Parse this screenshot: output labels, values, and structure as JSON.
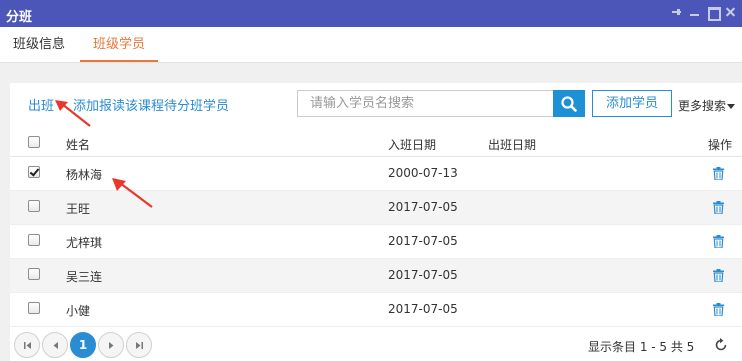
{
  "window": {
    "title": "分班"
  },
  "tabs": [
    {
      "label": "班级信息"
    },
    {
      "label": "班级学员"
    }
  ],
  "toolbar": {
    "dismiss_label": "出班",
    "add_pending_label": "添加报读该课程待分班学员",
    "search_placeholder": "请输入学员名搜索",
    "add_student_label": "添加学员",
    "more_search_label": "更多搜索"
  },
  "table": {
    "headers": {
      "name": "姓名",
      "enroll_date": "入班日期",
      "leave_date": "出班日期",
      "actions": "操作"
    },
    "rows": [
      {
        "name": "杨林海",
        "enroll_date": "2000-07-13",
        "leave_date": "",
        "checked": true
      },
      {
        "name": "王旺",
        "enroll_date": "2017-07-05",
        "leave_date": "",
        "checked": false
      },
      {
        "name": "尤梓琪",
        "enroll_date": "2017-07-05",
        "leave_date": "",
        "checked": false
      },
      {
        "name": "吴三连",
        "enroll_date": "2017-07-05",
        "leave_date": "",
        "checked": false
      },
      {
        "name": "小健",
        "enroll_date": "2017-07-05",
        "leave_date": "",
        "checked": false
      }
    ]
  },
  "pager": {
    "current_page": "1",
    "info": "显示条目 1 - 5 共 5"
  },
  "colors": {
    "title_bar": "#4c56b8",
    "accent_blue": "#2a8dd4",
    "tab_active": "#e8783c",
    "annotation_arrow": "#e8382c"
  }
}
